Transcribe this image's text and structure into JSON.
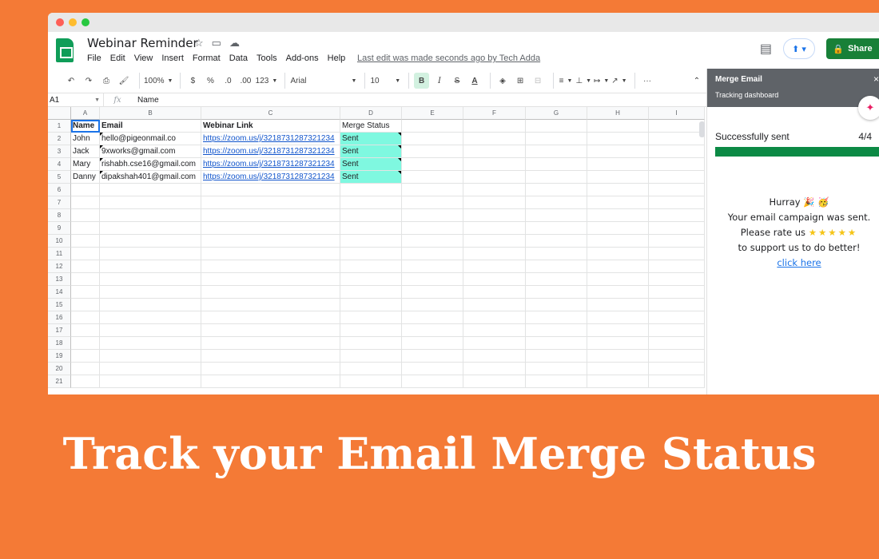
{
  "app": {
    "title": "Webinar Reminder",
    "menu": [
      "File",
      "Edit",
      "View",
      "Insert",
      "Format",
      "Data",
      "Tools",
      "Add-ons",
      "Help"
    ],
    "last_edit": "Last edit was made seconds ago by Tech Adda",
    "share_label": "Share"
  },
  "toolbar": {
    "zoom": "100%",
    "currency": "$",
    "percent": "%",
    "dec_less": ".0",
    "dec_more": ".00",
    "format_more": "123",
    "font": "Arial",
    "font_size": "10",
    "bold": "B",
    "strike": "S",
    "text_color": "A",
    "more": "···"
  },
  "formula_bar": {
    "cell_ref": "A1",
    "fx": "fx",
    "value": "Name"
  },
  "sheet": {
    "columns": [
      "A",
      "B",
      "C",
      "D",
      "E",
      "F",
      "G",
      "H",
      "I"
    ],
    "row_numbers": [
      "1",
      "2",
      "3",
      "4",
      "5",
      "6",
      "7",
      "8",
      "9",
      "10",
      "11",
      "12",
      "13",
      "14",
      "15",
      "16",
      "17",
      "18",
      "19",
      "20",
      "21"
    ],
    "header": [
      "Name",
      "Email",
      "Webinar Link",
      "Merge Status"
    ],
    "rows": [
      [
        "John",
        "hello@pigeonmail.co",
        "https://zoom.us/j/3218731287321234",
        "Sent"
      ],
      [
        "Jack",
        "9xworks@gmail.com",
        "https://zoom.us/j/3218731287321234",
        "Sent"
      ],
      [
        "Mary",
        "rishabh.cse16@gmail.com",
        "https://zoom.us/j/3218731287321234",
        "Sent"
      ],
      [
        "Danny",
        "dipakshah401@gmail.com",
        "https://zoom.us/j/3218731287321234",
        "Sent"
      ]
    ],
    "status_color": "#7ff8e0"
  },
  "panel": {
    "title": "Merge Email",
    "subtitle": "Tracking dashboard",
    "close": "×",
    "progress_label": "Successfully sent",
    "progress_value": "4/4",
    "progress_fraction": 1.0,
    "progress_color": "#0c8a45",
    "line1": "Hurray 🎉 🥳",
    "line2": "Your email campaign was sent.",
    "line3_prefix": "Please rate us",
    "stars": "★★★★★",
    "line4": "to support us to do better!",
    "link": "click here"
  },
  "caption": "Track your Email Merge Status",
  "colors": {
    "background": "#f47a36",
    "share": "#188038",
    "accent": "#1a73e8"
  }
}
